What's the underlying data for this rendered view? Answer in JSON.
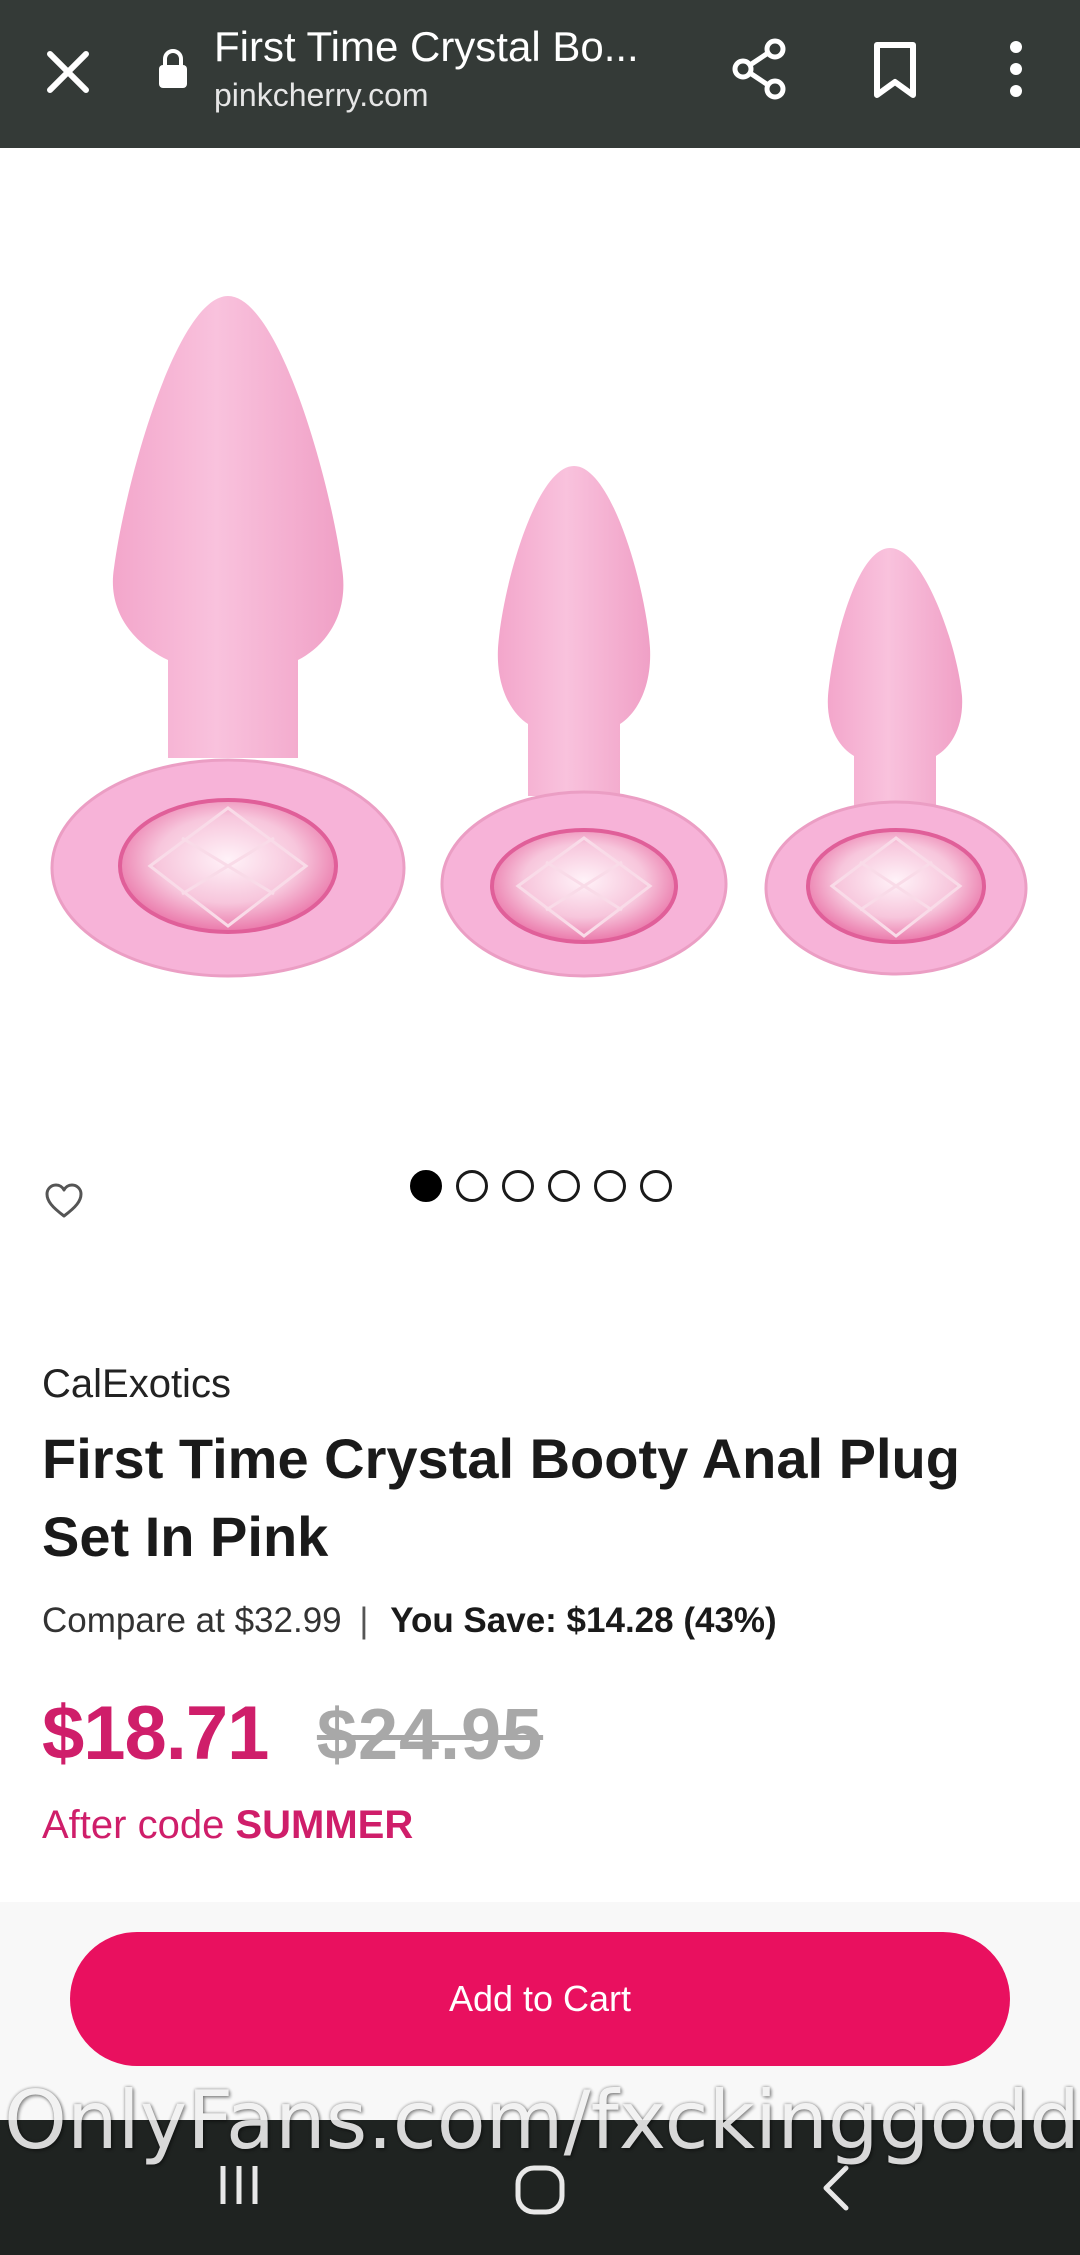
{
  "browser": {
    "title": "First Time Crystal Bo...",
    "url": "pinkcherry.com",
    "icons": [
      "close-icon",
      "lock-icon",
      "share-icon",
      "bookmark-icon",
      "more-vert-icon"
    ]
  },
  "gallery": {
    "image_count": 6,
    "active_index": 0,
    "favorite_icon": "heart-outline-icon"
  },
  "product": {
    "brand": "CalExotics",
    "name": "First Time Crystal Booty Anal Plug Set In Pink",
    "compare_label": "Compare at $32.99",
    "separator": "|",
    "save_label": "You Save: $14.28 (43%)",
    "price": "$18.71",
    "original_price": "$24.95",
    "after_code_prefix": "After code",
    "promo_code": "SUMMER"
  },
  "cart": {
    "button_label": "Add to Cart"
  },
  "watermark": {
    "text": "OnlyFans.com/fxckinggodde"
  },
  "nav": {
    "icons": [
      "recents-icon",
      "home-icon",
      "back-icon"
    ]
  },
  "colors": {
    "toolbar_bg": "#343a37",
    "accent_pink": "#cf1e6a",
    "cart_button": "#e9105f",
    "product_pink": "#f7b3d8",
    "navbar_bg": "#1f2321"
  }
}
